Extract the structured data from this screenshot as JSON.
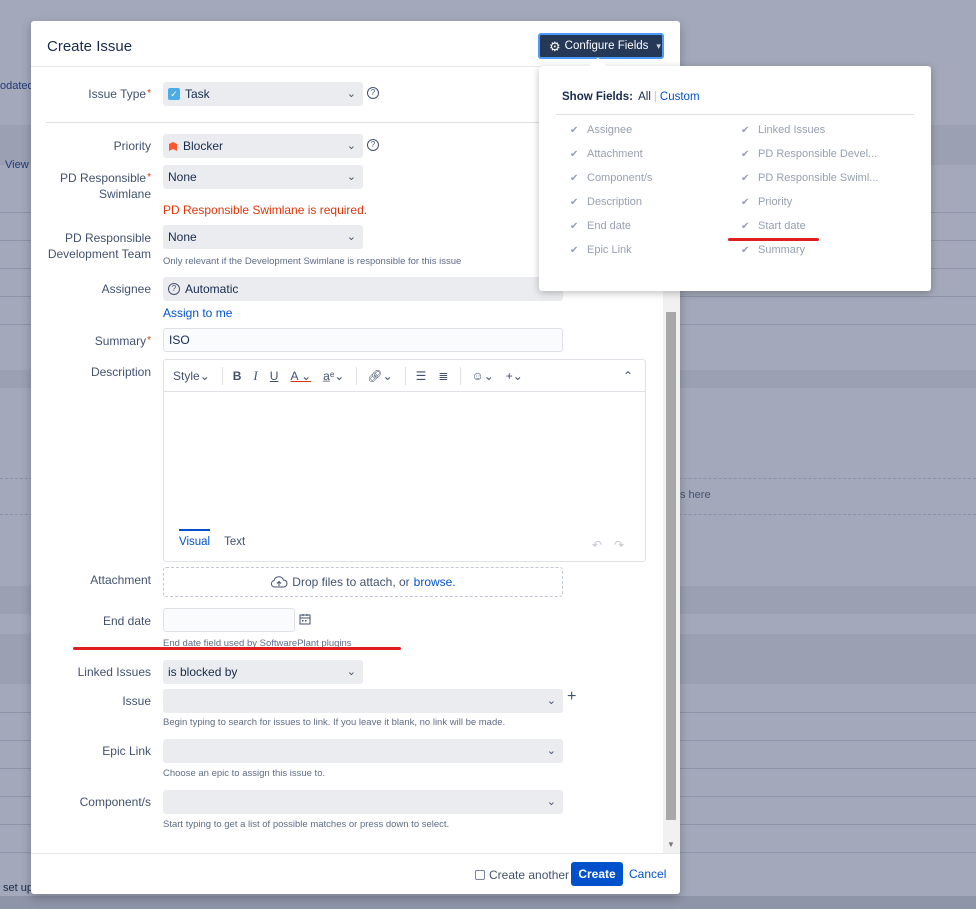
{
  "background": {
    "text_updated": "odated",
    "text_view": "View",
    "text_here": "s here",
    "text_setup": "set up"
  },
  "dialog": {
    "title": "Create Issue",
    "configure_label": "Configure Fields",
    "fields": {
      "issue_type": {
        "label": "Issue Type",
        "value": "Task"
      },
      "priority": {
        "label": "Priority",
        "value": "Blocker"
      },
      "pd_swimlane": {
        "label_line1": "PD Responsible",
        "label_line2": "Swimlane",
        "value": "None",
        "error": "PD Responsible Swimlane is required."
      },
      "pd_team": {
        "label_line1": "PD Responsible",
        "label_line2": "Development Team",
        "value": "None",
        "hint": "Only relevant if the Development Swimlane is responsible for this issue"
      },
      "assignee": {
        "label": "Assignee",
        "value": "Automatic",
        "assign_link": "Assign to me"
      },
      "summary": {
        "label": "Summary",
        "value": "ISO"
      },
      "description": {
        "label": "Description",
        "style_label": "Style",
        "tab_visual": "Visual",
        "tab_text": "Text"
      },
      "attachment": {
        "label": "Attachment",
        "drop_text": "Drop files to attach, or",
        "browse": "browse."
      },
      "end_date": {
        "label": "End date",
        "hint": "End date field used by SoftwarePlant plugins"
      },
      "linked_issues": {
        "label": "Linked Issues",
        "value": "is blocked by"
      },
      "issue": {
        "label": "Issue",
        "hint": "Begin typing to search for issues to link. If you leave it blank, no link will be made."
      },
      "epic_link": {
        "label": "Epic Link",
        "hint": "Choose an epic to assign this issue to."
      },
      "components": {
        "label": "Component/s",
        "hint": "Start typing to get a list of possible matches or press down to select."
      }
    },
    "footer": {
      "create_another": "Create another",
      "create": "Create",
      "cancel": "Cancel"
    }
  },
  "popup": {
    "show_fields": "Show Fields:",
    "all": "All",
    "custom": "Custom",
    "left_fields": [
      "Assignee",
      "Attachment",
      "Component/s",
      "Description",
      "End date",
      "Epic Link"
    ],
    "right_fields": [
      "Linked Issues",
      "PD Responsible Devel...",
      "PD Responsible Swiml...",
      "Priority",
      "Start date",
      "Summary"
    ]
  },
  "colors": {
    "primary": "#0052cc",
    "error": "#de350b",
    "annotation": "#e01e1e",
    "configure_bg": "#253858"
  }
}
